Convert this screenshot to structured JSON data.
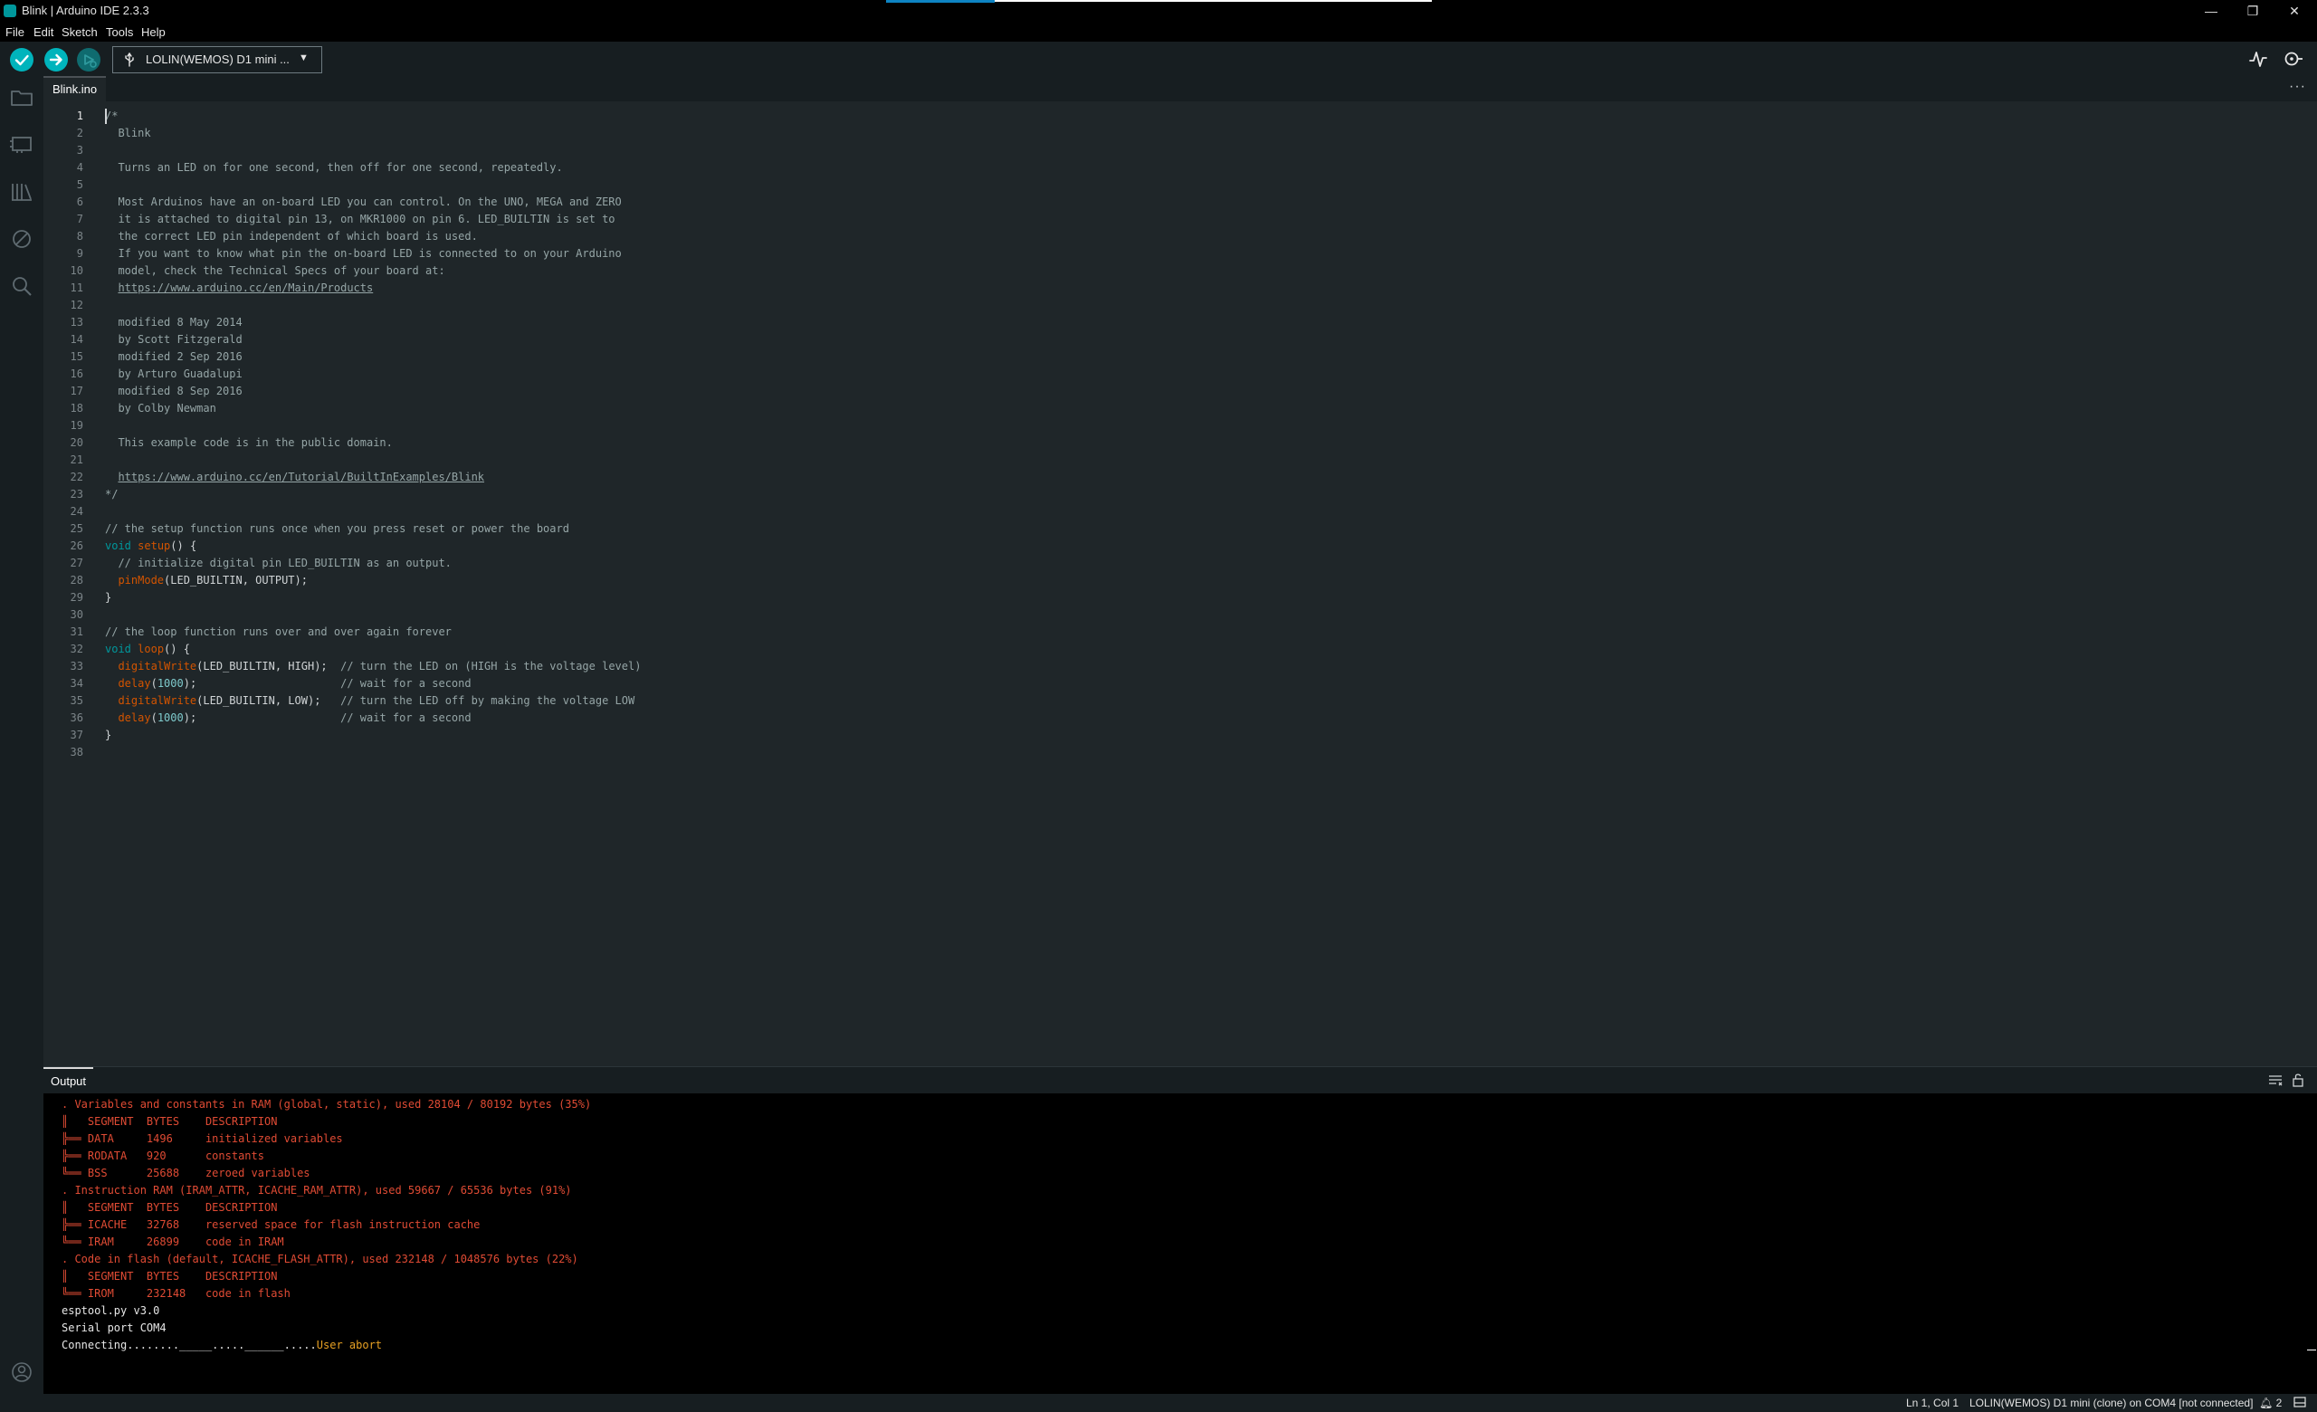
{
  "window": {
    "title": "Blink | Arduino IDE 2.3.3",
    "minimize": "—",
    "restore": "❐",
    "close": "✕"
  },
  "menu": [
    "File",
    "Edit",
    "Sketch",
    "Tools",
    "Help"
  ],
  "toolbar": {
    "board_name": "LOLIN(WEMOS) D1 mini ...",
    "chevron": "▼"
  },
  "editor": {
    "tab_label": "Blink.ino",
    "more_icon": "···",
    "lines": [
      [
        [
          "c",
          "/*"
        ]
      ],
      [
        [
          "c",
          "  Blink"
        ]
      ],
      [
        [
          "c",
          ""
        ]
      ],
      [
        [
          "c",
          "  Turns an LED on for one second, then off for one second, repeatedly."
        ]
      ],
      [
        [
          "c",
          ""
        ]
      ],
      [
        [
          "c",
          "  Most Arduinos have an on-board LED you can control. On the UNO, MEGA and ZERO"
        ]
      ],
      [
        [
          "c",
          "  it is attached to digital pin 13, on MKR1000 on pin 6. LED_BUILTIN is set to"
        ]
      ],
      [
        [
          "c",
          "  the correct LED pin independent of which board is used."
        ]
      ],
      [
        [
          "c",
          "  If you want to know what pin the on-board LED is connected to on your Arduino"
        ]
      ],
      [
        [
          "c",
          "  model, check the Technical Specs of your board at:"
        ]
      ],
      [
        [
          "c",
          "  "
        ],
        [
          "url",
          "https://www.arduino.cc/en/Main/Products"
        ]
      ],
      [
        [
          "c",
          ""
        ]
      ],
      [
        [
          "c",
          "  modified 8 May 2014"
        ]
      ],
      [
        [
          "c",
          "  by Scott Fitzgerald"
        ]
      ],
      [
        [
          "c",
          "  modified 2 Sep 2016"
        ]
      ],
      [
        [
          "c",
          "  by Arturo Guadalupi"
        ]
      ],
      [
        [
          "c",
          "  modified 8 Sep 2016"
        ]
      ],
      [
        [
          "c",
          "  by Colby Newman"
        ]
      ],
      [
        [
          "c",
          ""
        ]
      ],
      [
        [
          "c",
          "  This example code is in the public domain."
        ]
      ],
      [
        [
          "c",
          ""
        ]
      ],
      [
        [
          "c",
          "  "
        ],
        [
          "url",
          "https://www.arduino.cc/en/Tutorial/BuiltInExamples/Blink"
        ]
      ],
      [
        [
          "c",
          "*/"
        ]
      ],
      [
        [
          "c",
          ""
        ]
      ],
      [
        [
          "c",
          "// the setup function runs once when you press reset or power the board"
        ]
      ],
      [
        [
          "kw",
          "void"
        ],
        [
          "pl",
          " "
        ],
        [
          "fn",
          "setup"
        ],
        [
          "pl",
          "() {"
        ]
      ],
      [
        [
          "c",
          "  // initialize digital pin LED_BUILTIN as an output."
        ]
      ],
      [
        [
          "pl",
          "  "
        ],
        [
          "fn",
          "pinMode"
        ],
        [
          "pl",
          "(LED_BUILTIN, OUTPUT);"
        ]
      ],
      [
        [
          "pl",
          "}"
        ]
      ],
      [
        [
          "c",
          ""
        ]
      ],
      [
        [
          "c",
          "// the loop function runs over and over again forever"
        ]
      ],
      [
        [
          "kw",
          "void"
        ],
        [
          "pl",
          " "
        ],
        [
          "fn",
          "loop"
        ],
        [
          "pl",
          "() {"
        ]
      ],
      [
        [
          "pl",
          "  "
        ],
        [
          "fn",
          "digitalWrite"
        ],
        [
          "pl",
          "(LED_BUILTIN, HIGH);  "
        ],
        [
          "c",
          "// turn the LED on (HIGH is the voltage level)"
        ]
      ],
      [
        [
          "pl",
          "  "
        ],
        [
          "fn",
          "delay"
        ],
        [
          "pl",
          "("
        ],
        [
          "num",
          "1000"
        ],
        [
          "pl",
          ");                      "
        ],
        [
          "c",
          "// wait for a second"
        ]
      ],
      [
        [
          "pl",
          "  "
        ],
        [
          "fn",
          "digitalWrite"
        ],
        [
          "pl",
          "(LED_BUILTIN, LOW);   "
        ],
        [
          "c",
          "// turn the LED off by making the voltage LOW"
        ]
      ],
      [
        [
          "pl",
          "  "
        ],
        [
          "fn",
          "delay"
        ],
        [
          "pl",
          "("
        ],
        [
          "num",
          "1000"
        ],
        [
          "pl",
          ");                      "
        ],
        [
          "c",
          "// wait for a second"
        ]
      ],
      [
        [
          "pl",
          "}"
        ]
      ],
      [
        [
          "c",
          ""
        ]
      ]
    ]
  },
  "output": {
    "tab_label": "Output",
    "lines": [
      [
        "err",
        ". Variables and constants in RAM (global, static), used 28104 / 80192 bytes (35%)"
      ],
      [
        "err",
        "║   SEGMENT  BYTES    DESCRIPTION"
      ],
      [
        "err",
        "╠══ DATA     1496     initialized variables"
      ],
      [
        "err",
        "╠══ RODATA   920      constants"
      ],
      [
        "err",
        "╚══ BSS      25688    zeroed variables"
      ],
      [
        "err",
        ". Instruction RAM (IRAM_ATTR, ICACHE_RAM_ATTR), used 59667 / 65536 bytes (91%)"
      ],
      [
        "err",
        "║   SEGMENT  BYTES    DESCRIPTION"
      ],
      [
        "err",
        "╠══ ICACHE   32768    reserved space for flash instruction cache"
      ],
      [
        "err",
        "╚══ IRAM     26899    code in IRAM"
      ],
      [
        "err",
        ". Code in flash (default, ICACHE_FLASH_ATTR), used 232148 / 1048576 bytes (22%)"
      ],
      [
        "err",
        "║   SEGMENT  BYTES    DESCRIPTION"
      ],
      [
        "err",
        "╚══ IROM     232148   code in flash"
      ],
      [
        "std",
        "esptool.py v3.0"
      ],
      [
        "std",
        "Serial port COM4"
      ],
      [
        "mix",
        "Connecting........_____.....______.....",
        "User abort"
      ]
    ]
  },
  "status": {
    "cursor_position": "Ln 1, Col 1",
    "board_port": "LOLIN(WEMOS) D1 mini (clone) on COM4 [not connected]",
    "notifications": "2"
  },
  "colors": {
    "accent_teal": "#00979c",
    "error_text": "#e04b34",
    "warning_text": "#e6a023"
  }
}
